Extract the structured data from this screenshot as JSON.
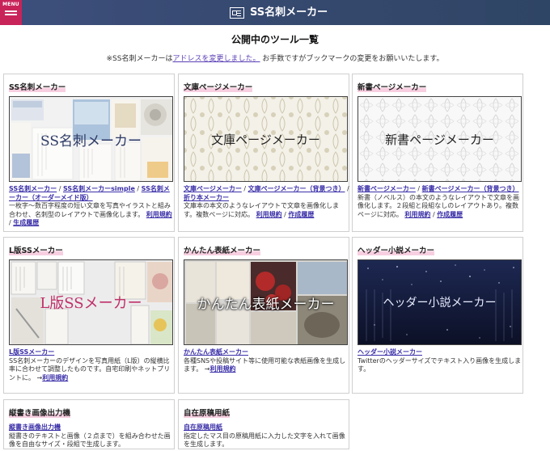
{
  "header": {
    "menu_label": "MENU",
    "title": "SS名刺メーカー"
  },
  "page": {
    "heading": "公開中のツール一覧",
    "notice_prefix": "※SS名刺メーカーは",
    "notice_link": "アドレスを変更しました。",
    "notice_suffix": "お手数ですがブックマークの変更をお願いいたします。"
  },
  "cards": [
    {
      "title": "SS名刺メーカー",
      "thumb_caption": "SS名刺メーカー",
      "links": [
        "SS名刺メーカー",
        "SS名刺メーカーsimple",
        "SS名刺メーカー（オーダーメイド版）"
      ],
      "description": "一枚字～数百字程度の短い文章を写真やイラストと組み合わせ、名刺型のレイアウトで画像化します。",
      "terms": "利用規約",
      "history": "生成履歴"
    },
    {
      "title": "文庫ページメーカー",
      "thumb_caption": "文庫ページメーカー",
      "links": [
        "文庫ページメーカー",
        "文庫ページメーカー（背景つき）",
        "折り本メーカー"
      ],
      "description": "文庫本の本文のようなレイアウトで文章を画像化します。複数ページに対応。",
      "terms": "利用規約",
      "history": "作成履歴"
    },
    {
      "title": "新書ページメーカー",
      "thumb_caption": "新書ページメーカー",
      "links": [
        "新書ページメーカー",
        "新書ページメーカー（背景つき）"
      ],
      "description": "新書（ノベルス）の本文のようなレイアウトで文章を画像化します。２段組と段組なしのレイアウトあり。複数ページに対応。",
      "terms": "利用規約",
      "history": "作成履歴"
    },
    {
      "title": "L版SSメーカー",
      "thumb_caption": "L版SSメーカー",
      "links": [
        "L版SSメーカー"
      ],
      "description": "SS名刺メーカーのデザインを写真用紙（L版）の縦横比率に合わせて調整したものです。自宅印刷やネットプリントに。",
      "terms": "利用規約",
      "history": ""
    },
    {
      "title": "かんたん表紙メーカー",
      "thumb_caption": "かんたん表紙メーカー",
      "links": [
        "かんたん表紙メーカー"
      ],
      "description": "各種SNSや投稿サイト等に使用可能な表紙画像を生成します。",
      "terms": "利用規約",
      "history": ""
    },
    {
      "title": "ヘッダー小説メーカー",
      "thumb_caption": "ヘッダー小説メーカー",
      "links": [
        "ヘッダー小説メーカー"
      ],
      "description": "Twitterのヘッダーサイズでテキスト入り画像を生成します。",
      "terms": "",
      "history": ""
    },
    {
      "title": "縦書き画像出力機",
      "thumb_caption": "",
      "links": [
        "縦書き画像出力機"
      ],
      "description": "縦書きのテキストと画像（２点まで）を組み合わせた画像を自由なサイズ・段組で生成します。",
      "terms": "",
      "history": ""
    },
    {
      "title": "自在原稿用紙",
      "thumb_caption": "",
      "links": [
        "自在原稿用紙"
      ],
      "description": "指定したマス目の原稿用紙に入力した文字を入れて画像を生成します。",
      "terms": "",
      "history": ""
    }
  ],
  "colors": {
    "header_bg": "#36496f",
    "menu_bg": "#c8245a",
    "link": "#3a2fa8",
    "title_highlight": "#f7cfe0",
    "lban_caption": "#c0306a"
  }
}
